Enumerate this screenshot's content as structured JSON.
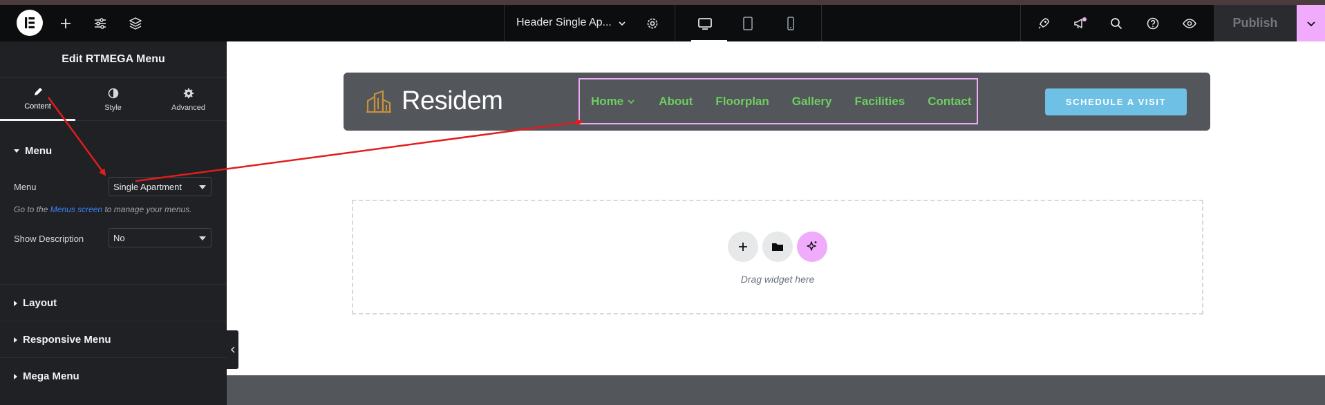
{
  "topbar": {
    "document_title": "Header Single Ap...",
    "publish_label": "Publish",
    "icons": [
      "elementor-logo-icon",
      "plus-icon",
      "sliders-icon",
      "layers-icon",
      "chevron-down-icon",
      "gear-icon",
      "desktop-icon",
      "tablet-icon",
      "mobile-icon",
      "rocket-icon",
      "megaphone-icon",
      "search-icon",
      "help-icon",
      "eye-icon",
      "chevron-down-icon"
    ]
  },
  "panel": {
    "title": "Edit RTMEGA Menu",
    "tabs": [
      {
        "label": "Content",
        "icon": "pencil-icon",
        "active": true
      },
      {
        "label": "Style",
        "icon": "half-circle-icon",
        "active": false
      },
      {
        "label": "Advanced",
        "icon": "gear-icon",
        "active": false
      }
    ],
    "menu_section": {
      "title": "Menu",
      "menu_label": "Menu",
      "menu_value": "Single Apartment",
      "help_prefix": "Go to the",
      "help_link": "Menus screen",
      "help_suffix": "to manage your menus.",
      "show_description_label": "Show Description",
      "show_description_value": "No"
    },
    "collapsed_sections": [
      "Layout",
      "Responsive Menu",
      "Mega Menu"
    ]
  },
  "canvas": {
    "brand_name": "Residem",
    "nav_items": [
      "Home",
      "About",
      "Floorplan",
      "Gallery",
      "Facilities",
      "Contact"
    ],
    "cta_label": "SCHEDULE A VISIT",
    "drop_text": "Drag widget here"
  },
  "colors": {
    "topbar_bg": "#0c0d0e",
    "panel_bg": "#1f2124",
    "nav_green": "#6dd05f",
    "cta_blue": "#6ec1e4",
    "accent_pink": "#f0abfc",
    "header_gray": "#53565b",
    "annotation_red": "#e11d1d",
    "brand_gold": "#c8913a"
  }
}
